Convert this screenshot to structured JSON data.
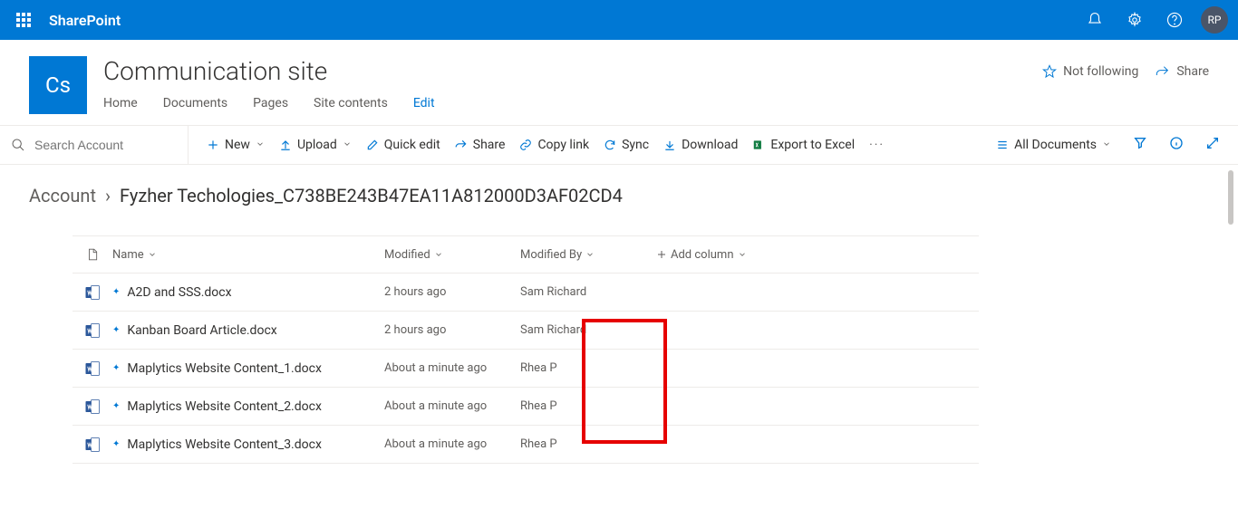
{
  "suite": {
    "app_name": "SharePoint",
    "user_initials": "RP"
  },
  "site": {
    "logo_text": "Cs",
    "title": "Communication site",
    "nav": [
      "Home",
      "Documents",
      "Pages",
      "Site contents",
      "Edit"
    ],
    "active_nav_index": 4,
    "actions": {
      "follow": "Not following",
      "share": "Share"
    }
  },
  "search": {
    "placeholder": "Search Account"
  },
  "commands": {
    "new": "New",
    "upload": "Upload",
    "quick_edit": "Quick edit",
    "share": "Share",
    "copy_link": "Copy link",
    "sync": "Sync",
    "download": "Download",
    "export": "Export to Excel",
    "view_label": "All Documents"
  },
  "breadcrumb": {
    "root": "Account",
    "current": "Fyzher Techologies_C738BE243B47EA11A812000D3AF02CD4"
  },
  "columns": {
    "name": "Name",
    "modified": "Modified",
    "modified_by": "Modified By",
    "add": "Add column"
  },
  "files": [
    {
      "name": "A2D and SSS.docx",
      "modified": "2 hours ago",
      "modified_by": "Sam Richard"
    },
    {
      "name": "Kanban Board Article.docx",
      "modified": "2 hours ago",
      "modified_by": "Sam Richard"
    },
    {
      "name": "Maplytics Website Content_1.docx",
      "modified": "About a minute ago",
      "modified_by": "Rhea P"
    },
    {
      "name": "Maplytics Website Content_2.docx",
      "modified": "About a minute ago",
      "modified_by": "Rhea P"
    },
    {
      "name": "Maplytics Website Content_3.docx",
      "modified": "About a minute ago",
      "modified_by": "Rhea P"
    }
  ]
}
